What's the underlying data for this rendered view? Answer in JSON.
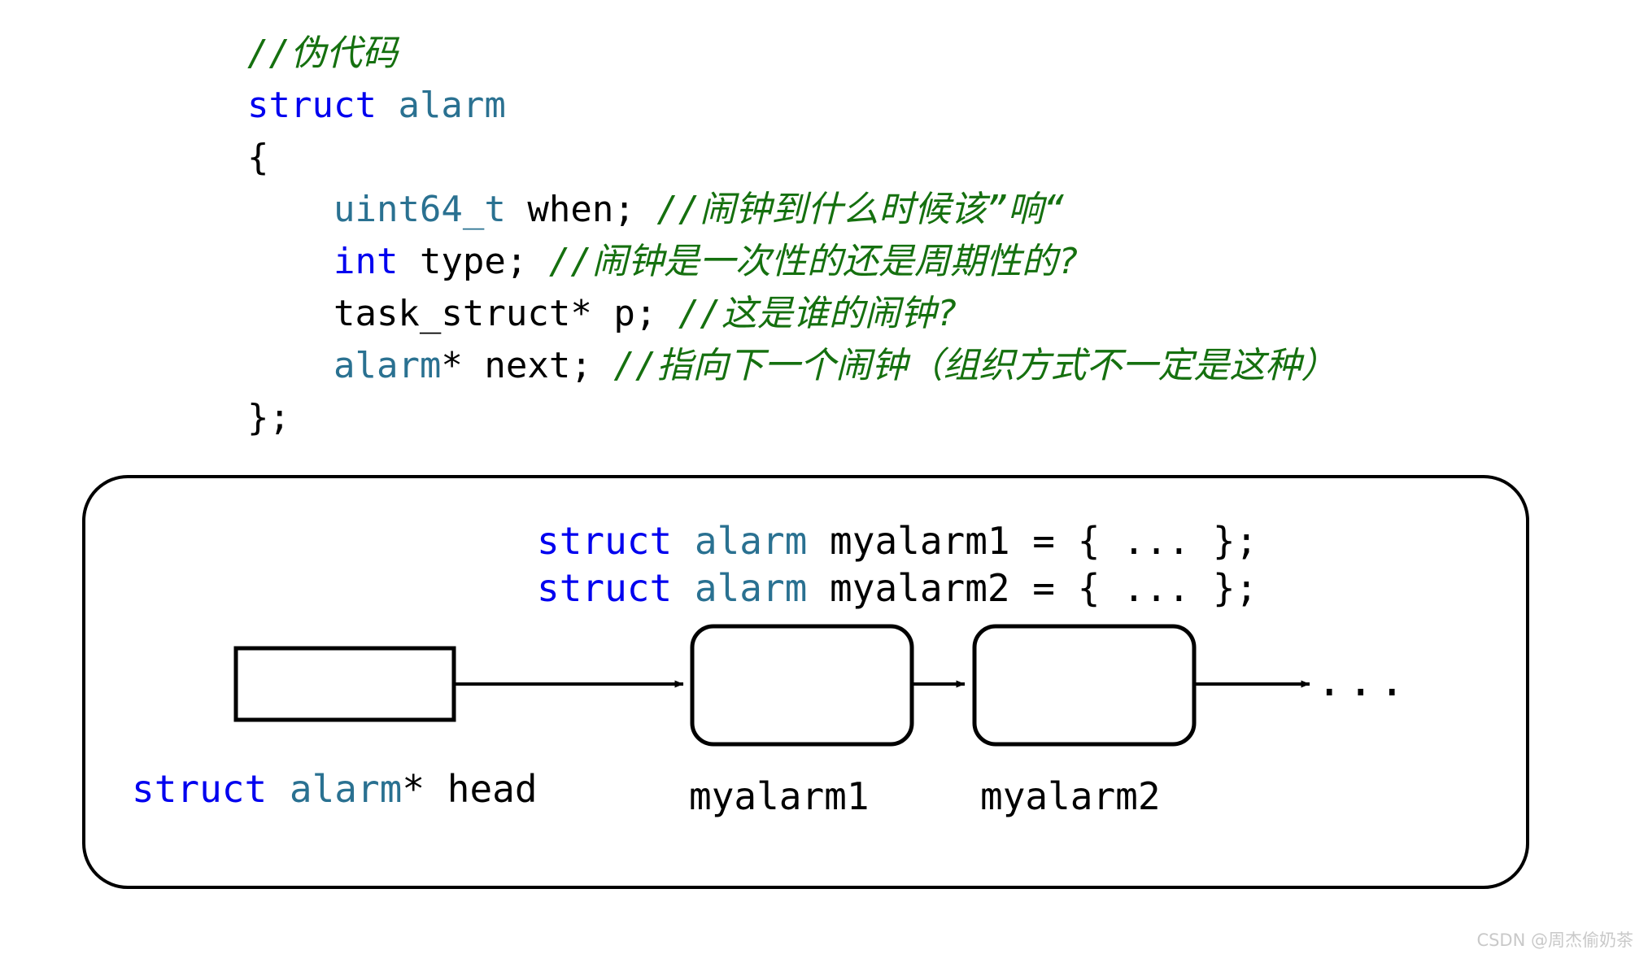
{
  "code": {
    "lines": [
      [
        {
          "t": "//伪代码",
          "c": "cmt"
        }
      ],
      [
        {
          "t": "struct",
          "c": "kw"
        },
        {
          "t": " ",
          "c": "plain"
        },
        {
          "t": "alarm",
          "c": "type"
        }
      ],
      [
        {
          "t": "{",
          "c": "plain"
        }
      ],
      [
        {
          "t": "    ",
          "c": "plain"
        },
        {
          "t": "uint64_t",
          "c": "type"
        },
        {
          "t": " when; ",
          "c": "plain"
        },
        {
          "t": "//闹钟到什么时候该”响“",
          "c": "cmt"
        }
      ],
      [
        {
          "t": "    ",
          "c": "plain"
        },
        {
          "t": "int",
          "c": "kw"
        },
        {
          "t": " type; ",
          "c": "plain"
        },
        {
          "t": "//闹钟是一次性的还是周期性的?",
          "c": "cmt"
        }
      ],
      [
        {
          "t": "    task_struct* p; ",
          "c": "plain"
        },
        {
          "t": "//这是谁的闹钟?",
          "c": "cmt"
        }
      ],
      [
        {
          "t": "    ",
          "c": "plain"
        },
        {
          "t": "alarm",
          "c": "type"
        },
        {
          "t": "* next; ",
          "c": "plain"
        },
        {
          "t": "//指向下一个闹钟（组织方式不一定是这种）",
          "c": "cmt"
        }
      ],
      [
        {
          "t": "};",
          "c": "plain"
        }
      ]
    ]
  },
  "diagram": {
    "declarations": [
      [
        {
          "t": "struct",
          "c": "kw"
        },
        {
          "t": " ",
          "c": "plain"
        },
        {
          "t": "alarm",
          "c": "type"
        },
        {
          "t": " myalarm1 = { ... };",
          "c": "plain"
        }
      ],
      [
        {
          "t": "struct",
          "c": "kw"
        },
        {
          "t": " ",
          "c": "plain"
        },
        {
          "t": "alarm",
          "c": "type"
        },
        {
          "t": " myalarm2 = { ... };",
          "c": "plain"
        }
      ]
    ],
    "head_caption": [
      {
        "t": "struct",
        "c": "kw"
      },
      {
        "t": " ",
        "c": "plain"
      },
      {
        "t": "alarm",
        "c": "type"
      },
      {
        "t": "* head",
        "c": "plain"
      }
    ],
    "node1_caption": "myalarm1",
    "node2_caption": "myalarm2",
    "tail_ellipsis": "...",
    "nodes": [
      {
        "name": "head-pointer-box",
        "shape": "rectangle"
      },
      {
        "name": "myalarm1-node-box",
        "shape": "rounded-rectangle"
      },
      {
        "name": "myalarm2-node-box",
        "shape": "rounded-rectangle"
      }
    ]
  },
  "watermark": {
    "text": "CSDN @周杰偷奶茶"
  },
  "colors": {
    "keyword": "#0000ef",
    "type": "#2a7191",
    "comment": "#15700f",
    "text": "#000000",
    "stroke": "#000000",
    "background": "#ffffff",
    "watermark": "#c9c9c9"
  }
}
